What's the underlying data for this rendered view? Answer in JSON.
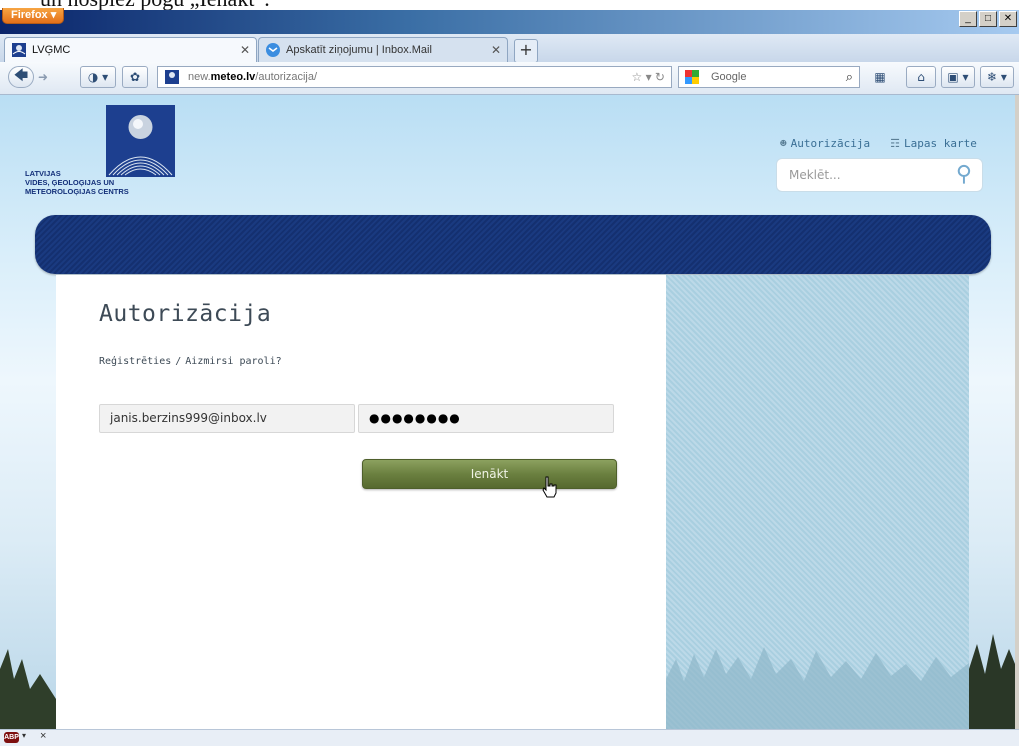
{
  "top_caption": "un nospiež pogu „Ienākt”.",
  "browser": {
    "app_button": "Firefox",
    "window_controls": [
      "_",
      "□",
      "✕"
    ],
    "tabs": [
      {
        "title": "LVĢMC",
        "active": true
      },
      {
        "title": "Apskatīt ziņojumu | Inbox.Mail",
        "active": false
      }
    ],
    "new_tab": "+",
    "url": {
      "prefix": "new.",
      "host": "meteo.lv",
      "path": "/autorizacija/"
    },
    "search_engine": "Google"
  },
  "site": {
    "logo_text": "LATVIJAS\nVIDES, ĢEOLOĢIJAS UN\nMETEOROLOĢIJAS CENTRS",
    "header_links": {
      "auth": "Autorizācija",
      "sitemap": "Lapas karte"
    },
    "search_placeholder": "Meklēt..."
  },
  "login": {
    "title": "Autorizācija",
    "register_link": "Reģistrēties",
    "separator": "/",
    "forgot_link": "Aizmirsi paroli?",
    "email_value": "janis.berzins999@inbox.lv",
    "password_value": "●●●●●●●●",
    "button": "Ienākt"
  },
  "statusbar": {
    "abp": "ABP",
    "close": "×"
  },
  "colors": {
    "nav_band": "#1a3a80",
    "button_green": "#6b8040",
    "title_text": "#3d4a56"
  }
}
